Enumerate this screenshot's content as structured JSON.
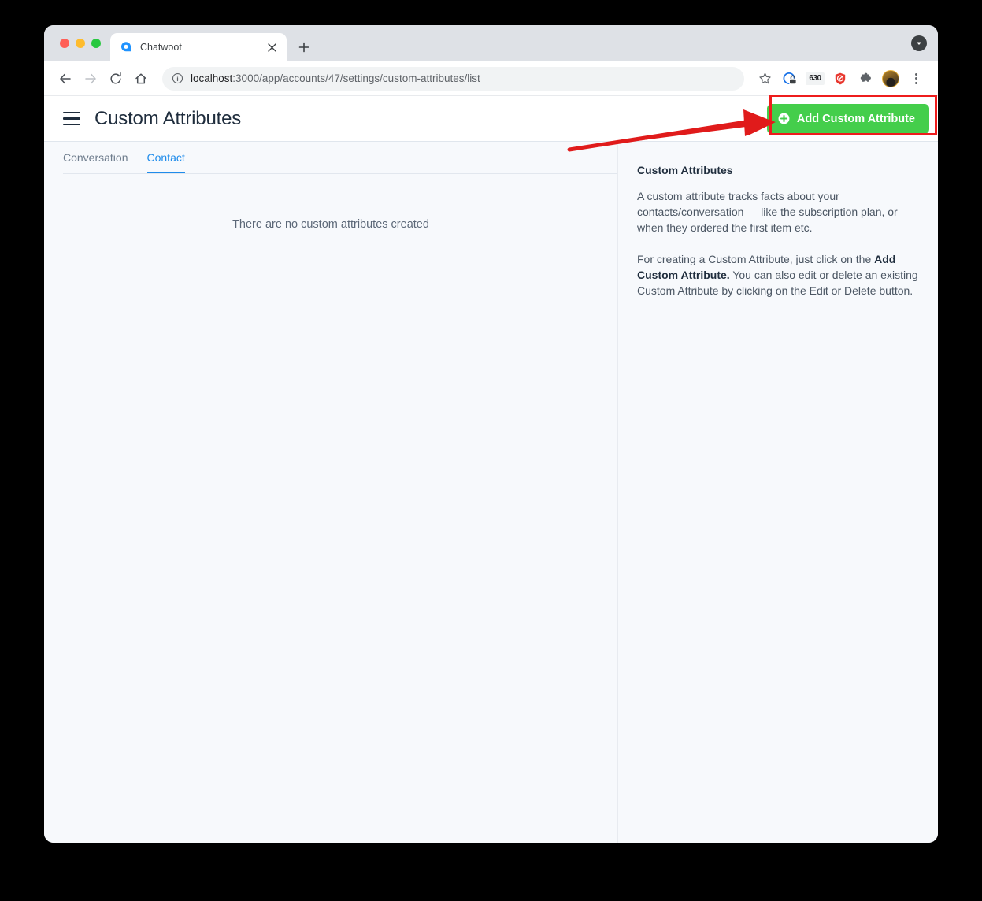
{
  "browser": {
    "tab": {
      "title": "Chatwoot",
      "favicon_name": "chatwoot-logo-icon",
      "close_label": "×"
    },
    "new_tab_label": "+",
    "toolbar": {
      "back_label": "←",
      "forward_label": "→",
      "reload_label": "↻",
      "home_label": "⌂",
      "url_scheme_host": "localhost",
      "url_rest": ":3000/app/accounts/47/settings/custom-attributes/list",
      "url_full": "localhost:3000/app/accounts/47/settings/custom-attributes/list",
      "bookmark_label": "☆",
      "extension_630_label": "630",
      "icons": [
        "site-info-icon",
        "bookmark-star-icon",
        "password-manager-icon",
        "extension-630-icon",
        "adblock-shield-icon",
        "extensions-puzzle-icon",
        "profile-avatar-icon",
        "browser-menu-kebab-icon"
      ]
    },
    "download_indicator_name": "download-badge-icon"
  },
  "app": {
    "header": {
      "menu_icon": "hamburger-menu-icon",
      "title": "Custom Attributes",
      "add_button": {
        "label": "Add Custom Attribute",
        "icon": "plus-circle-icon",
        "color": "#44ce4b"
      }
    },
    "tabs": [
      {
        "label": "Conversation",
        "active": false
      },
      {
        "label": "Contact",
        "active": true
      }
    ],
    "empty_state": "There are no custom attributes created",
    "sidebar": {
      "title": "Custom Attributes",
      "paragraph_1": "A custom attribute tracks facts about your contacts/conversation — like the subscription plan, or when they ordered the first item etc.",
      "paragraph_2_part_1": "For creating a Custom Attribute, just click on the ",
      "paragraph_2_bold": "Add Custom Attribute.",
      "paragraph_2_part_2": " You can also edit or delete an existing Custom Attribute by clicking on the Edit or Delete button."
    }
  },
  "annotations": {
    "highlight_color": "#ee1c1c",
    "rect_target": "add-custom-attribute-button",
    "arrow_target": "add-custom-attribute-button"
  }
}
